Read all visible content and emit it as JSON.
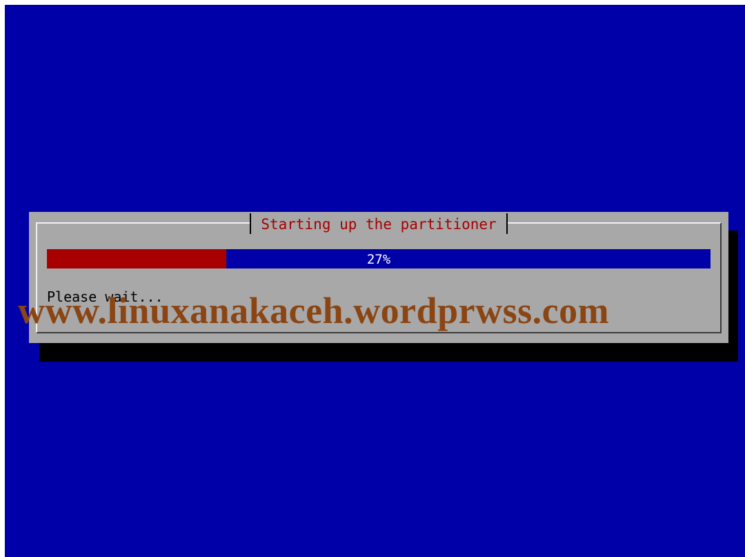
{
  "dialog": {
    "title": "Starting up the partitioner",
    "progress_percent": 27,
    "progress_label": "27%",
    "status_text": "Please wait..."
  },
  "watermark": {
    "text": "www.linuxanakaceh.wordprwss.com"
  },
  "colors": {
    "background": "#0000a8",
    "dialog": "#a8a8a8",
    "progress_fill": "#a80000",
    "title_text": "#a80000",
    "watermark": "#8b4513"
  }
}
